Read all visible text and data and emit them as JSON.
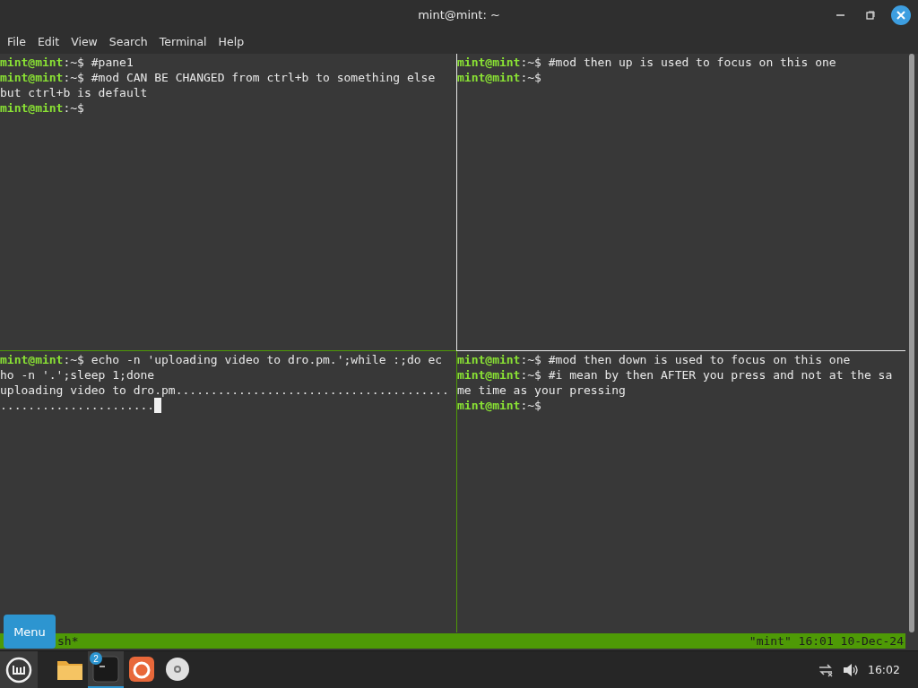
{
  "window": {
    "title": "mint@mint: ~"
  },
  "menu": [
    "File",
    "Edit",
    "View",
    "Search",
    "Terminal",
    "Help"
  ],
  "panes": [
    {
      "lines": [
        {
          "prompt": "mint@mint",
          "path": ":~$",
          "text": " #pane1"
        },
        {
          "prompt": "mint@mint",
          "path": ":~$",
          "text": " #mod CAN BE CHANGED from ctrl+b to something else"
        },
        {
          "text": "but ctrl+b is default"
        },
        {
          "prompt": "mint@mint",
          "path": ":~$"
        }
      ]
    },
    {
      "lines": [
        {
          "prompt": "mint@mint",
          "path": ":~$",
          "text": " #mod then up is used to focus on this one"
        },
        {
          "prompt": "mint@mint",
          "path": ":~$"
        }
      ]
    },
    {
      "lines": [
        {
          "prompt": "mint@mint",
          "path": ":~$",
          "text": " echo -n 'uploading video to dro.pm.';while :;do ec"
        },
        {
          "text": "ho -n '.';sleep 1;done"
        },
        {
          "text": "uploading video to dro.pm......................................."
        },
        {
          "text": "......................",
          "cursor": true
        }
      ]
    },
    {
      "lines": [
        {
          "prompt": "mint@mint",
          "path": ":~$",
          "text": " #mod then down is used to focus on this one"
        },
        {
          "prompt": "mint@mint",
          "path": ":~$",
          "text": " #i mean by then AFTER you press and not at the sa"
        },
        {
          "text": "me time as your pressing"
        },
        {
          "prompt": "mint@mint",
          "path": ":~$"
        }
      ]
    }
  ],
  "status_bar": {
    "left": "sh*",
    "right": "\"mint\" 16:01 10-Dec-24"
  },
  "tooltip": "Menu",
  "taskbar": {
    "apps": [
      {
        "kind": "folder",
        "active": false
      },
      {
        "kind": "terminal",
        "active": true,
        "badge": "2"
      },
      {
        "kind": "firefox",
        "active": false
      },
      {
        "kind": "disc",
        "active": false
      }
    ],
    "clock": "16:02"
  }
}
